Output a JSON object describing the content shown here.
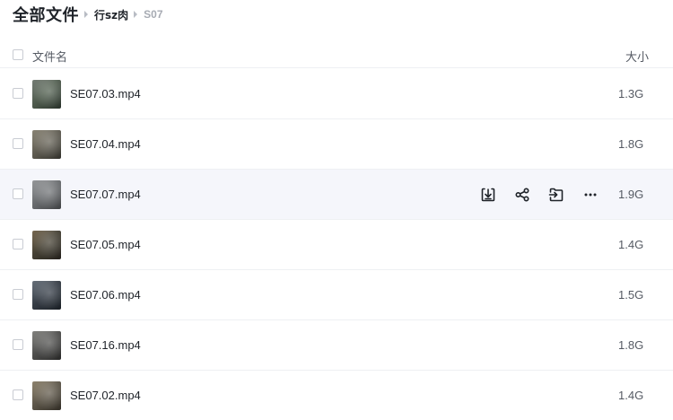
{
  "breadcrumb": {
    "root": "全部文件",
    "parent": "行sz肉",
    "current": "S07"
  },
  "table": {
    "columns": {
      "name": "文件名",
      "size": "大小"
    },
    "rows": [
      {
        "name": "SE07.03.mp4",
        "size": "1.3G",
        "thumb": [
          "#5c6a5a",
          "#2f3a31",
          "#8a938a"
        ]
      },
      {
        "name": "SE07.04.mp4",
        "size": "1.8G",
        "thumb": [
          "#6e6a5e",
          "#3b3a33",
          "#a29c8a"
        ]
      },
      {
        "name": "SE07.07.mp4",
        "size": "1.9G",
        "thumb": [
          "#7a7d80",
          "#4b4d50",
          "#b1b3b5"
        ],
        "hover": true
      },
      {
        "name": "SE07.05.mp4",
        "size": "1.4G",
        "thumb": [
          "#4f4a3c",
          "#2a2620",
          "#8c7a5e"
        ]
      },
      {
        "name": "SE07.06.mp4",
        "size": "1.5G",
        "thumb": [
          "#3e4650",
          "#1e242b",
          "#7b8591"
        ]
      },
      {
        "name": "SE07.16.mp4",
        "size": "1.8G",
        "thumb": [
          "#5a5a58",
          "#2e2e2d",
          "#9b9b97"
        ]
      },
      {
        "name": "SE07.02.mp4",
        "size": "1.4G",
        "thumb": [
          "#6b6354",
          "#3a352c",
          "#a89b82"
        ]
      }
    ]
  },
  "row_actions": [
    {
      "icon": "download-icon",
      "name": "download-button"
    },
    {
      "icon": "share-icon",
      "name": "share-button"
    },
    {
      "icon": "move-icon",
      "name": "move-button"
    },
    {
      "icon": "more-icon",
      "name": "more-button"
    }
  ],
  "colors": {
    "hover_row": "#f5f6fb",
    "text": "#1f2329",
    "muted": "#555a63"
  }
}
